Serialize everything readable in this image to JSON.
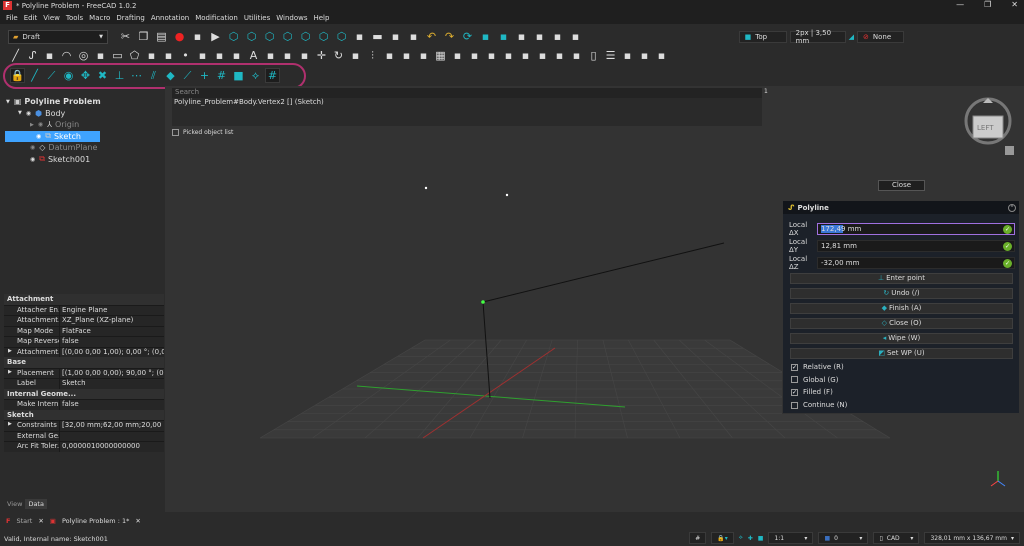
{
  "window": {
    "title": "* Polyline Problem - FreeCAD 1.0.2",
    "controls": [
      "—",
      "❐",
      "✕"
    ]
  },
  "menu": [
    "File",
    "Edit",
    "View",
    "Tools",
    "Macro",
    "Drafting",
    "Annotation",
    "Modification",
    "Utilities",
    "Windows",
    "Help"
  ],
  "workbench": {
    "label": "Draft"
  },
  "toolbar_right": {
    "view": "Top",
    "line": "2px | 3,50 mm",
    "style": "None"
  },
  "toolbar1_icons": [
    "cut-icon",
    "copy-icon",
    "paste-icon",
    "record-macro-icon",
    "macro-editor-icon",
    "run-macro-icon",
    "view-isometric-icon",
    "view-front-icon",
    "view-top-icon",
    "view-right-icon",
    "view-rear-icon",
    "view-bottom-icon",
    "view-left-icon",
    "part-icon",
    "folder-icon",
    "export-icon",
    "expression-icon",
    "undo-icon",
    "redo-icon",
    "refresh-icon",
    "zoom-all-icon",
    "zoom-selection-icon",
    "draw-style-icon",
    "bounding-box-icon",
    "measure-icon",
    "whats-this-icon"
  ],
  "toolbar2_icons": [
    "line-icon",
    "polyline-icon",
    "fillet-icon",
    "arc-icon",
    "circle-icon",
    "ellipse-icon",
    "rectangle-icon",
    "polygon-icon",
    "bspline-icon",
    "bezier-icon",
    "point-icon",
    "facebinder-icon",
    "shapestring-icon",
    "hatch-icon",
    "text-icon",
    "dimension-icon",
    "label-icon",
    "annotation-style-icon",
    "move-icon",
    "rotate-icon",
    "scale-icon",
    "mirror-icon",
    "offset-icon",
    "trimex-icon",
    "stretch-icon",
    "array-icon",
    "clone-icon",
    "join-icon",
    "split-icon",
    "upgrade-icon",
    "downgrade-icon",
    "wire-to-bspline-icon",
    "draft-to-sketch-icon",
    "layer-icon",
    "page-icon",
    "list-icon",
    "manager-icon",
    "group-icon",
    "select-group-icon"
  ],
  "snap_toolbar_icons": [
    "snap-lock-icon",
    "snap-endpoint-icon",
    "snap-midpoint-icon",
    "snap-center-icon",
    "snap-angle-icon",
    "snap-intersection-icon",
    "snap-perpendicular-icon",
    "snap-extension-icon",
    "snap-parallel-icon",
    "snap-special-icon",
    "snap-near-icon",
    "snap-ortho-icon",
    "snap-grid-icon",
    "snap-working-plane-icon",
    "snap-dimensions-icon",
    "toggle-grid-icon"
  ],
  "tree": [
    {
      "label": "Polyline Problem",
      "level": 0
    },
    {
      "label": "Body",
      "level": 1
    },
    {
      "label": "Origin",
      "level": 2
    },
    {
      "label": "Sketch",
      "level": 2
    },
    {
      "label": "DatumPlane",
      "level": 2
    },
    {
      "label": "Sketch001",
      "level": 2
    }
  ],
  "search": {
    "placeholder": "Search",
    "selection": "Polyline_Problem#Body.Vertex2 [] (Sketch)",
    "picked_label": "Picked object list",
    "count": "1"
  },
  "properties": [
    {
      "group": "Attachment",
      "rows": [
        {
          "k": "Attacher En...",
          "v": "Engine Plane"
        },
        {
          "k": "Attachment...",
          "v": "XZ_Plane (XZ-plane)"
        },
        {
          "k": "Map Mode",
          "v": "FlatFace"
        },
        {
          "k": "Map Reversed",
          "v": "false"
        },
        {
          "k": "Attachment...",
          "v": "[(0,00 0,00 1,00); 0,00 °; (0,00 mm ...",
          "exp": true
        }
      ]
    },
    {
      "group": "Base",
      "rows": [
        {
          "k": "Placement",
          "v": "[(1,00 0,00 0,00); 90,00 °; (0,00 mm ...",
          "exp": true
        },
        {
          "k": "Label",
          "v": "Sketch"
        }
      ]
    },
    {
      "group": "Internal Geome...",
      "rows": [
        {
          "k": "Make Intern...",
          "v": "false"
        }
      ]
    },
    {
      "group": "Sketch",
      "rows": [
        {
          "k": "Constraints",
          "v": "[32,00 mm;62,00 mm;20,00 mm]",
          "exp": true
        },
        {
          "k": "External Ge...",
          "v": ""
        },
        {
          "k": "Arc Fit Toler...",
          "v": "0,0000010000000000"
        }
      ]
    }
  ],
  "close_button": "Close",
  "polyline_panel": {
    "title": "Polyline",
    "fields": [
      {
        "label": "Local ΔX",
        "value": "172,49 mm"
      },
      {
        "label": "Local ΔY",
        "value": "12,81 mm"
      },
      {
        "label": "Local ΔZ",
        "value": "-32,00 mm"
      }
    ],
    "buttons": [
      "Enter point",
      "Undo (/)",
      "Finish (A)",
      "Close (O)",
      "Wipe (W)",
      "Set WP (U)"
    ],
    "checks": [
      {
        "label": "Relative (R)",
        "checked": true
      },
      {
        "label": "Global (G)",
        "checked": false
      },
      {
        "label": "Filled (F)",
        "checked": true
      },
      {
        "label": "Continue (N)",
        "checked": false
      }
    ]
  },
  "navcube": {
    "face": "LEFT"
  },
  "panel_tabs": [
    "View",
    "Data"
  ],
  "doc_tabs": [
    "Start",
    "Polyline Problem : 1*"
  ],
  "status": {
    "message": "Valid, Internal name: Sketch001",
    "scale": "1:1",
    "layer": "0",
    "nav": "CAD",
    "dimensions": "328,01 mm x 136,67 mm"
  }
}
